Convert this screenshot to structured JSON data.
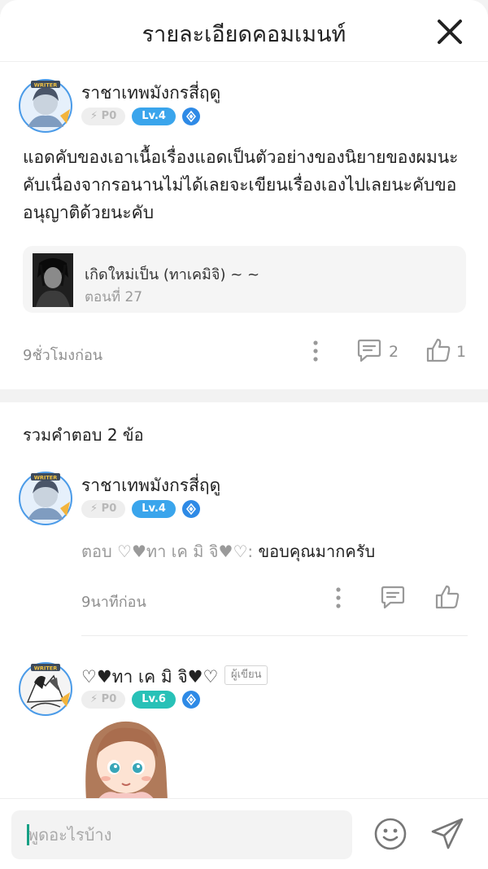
{
  "header": {
    "title": "รายละเอียดคอมเมนท์"
  },
  "comment": {
    "user": {
      "name": "ราชาเทพมังกรสี่ฤดู",
      "points": "P0",
      "level": "Lv.4",
      "avatar_label": "WRITER"
    },
    "text": "แอดคับของเอาเนื้อเรื่องแอดเป็นตัวอย่างของนิยายของผมนะคับเนื่องจากรอนานไม่ได้เลยจะเขียนเรื่องเองไปเลยนะคับขออนุญาติด้วยนะคับ",
    "episode": {
      "title": "เกิดใหม่เป็น (ทาเคมิจิ) ~ ~",
      "number": "ตอนที่ 27"
    },
    "time": "9ชั่วโมงก่อน",
    "reply_count": "2",
    "like_count": "1"
  },
  "replies": {
    "heading": "รวมคำตอบ 2 ข้อ",
    "items": [
      {
        "name": "ราชาเทพมังกรสี่ฤดู",
        "points": "P0",
        "level": "Lv.4",
        "reply_to": "ตอบ ♡♥ทา เค มิ จิ♥♡:",
        "text": " ขอบคุณมากครับ",
        "time": "9นาทีก่อน"
      },
      {
        "name": "♡♥ทา เค มิ จิ♥♡",
        "author_tag": "ผู้เขียน",
        "points": "P0",
        "level": "Lv.6"
      }
    ]
  },
  "input": {
    "placeholder": "พูดอะไรบ้าง"
  },
  "colors": {
    "level4": "#3aa5ec",
    "level6": "#28c1b7",
    "gem": "#2e8ae6",
    "caret": "#16a085"
  },
  "icons": [
    "close-icon",
    "more-vertical-icon",
    "comment-icon",
    "thumbs-up-icon",
    "emoji-icon",
    "send-icon",
    "diamond-icon",
    "bolt-icon"
  ]
}
